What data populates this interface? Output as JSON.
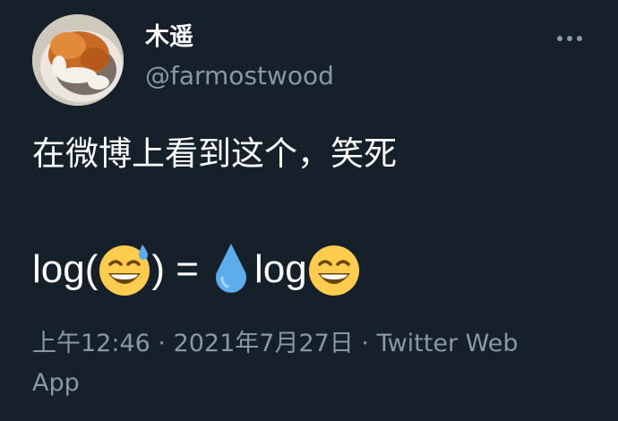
{
  "user": {
    "display_name": "木遥",
    "handle": "@farmostwood"
  },
  "tweet": {
    "text": "在微博上看到这个，笑死",
    "formula": {
      "part1": "log(",
      "emoji1": "sweat-smile-emoji",
      "part2": ") =",
      "emoji2": "droplet-emoji",
      "part3": "log",
      "emoji3": "grinning-smile-emoji"
    },
    "time": "上午12:46",
    "separator": " · ",
    "date": "2021年7月27日",
    "source": "Twitter Web App"
  },
  "colors": {
    "background": "#15202b",
    "primary_text": "#ffffff",
    "secondary_text": "#8899a6",
    "emoji_yellow": "#ffcc4d",
    "droplet_blue": "#5dadec"
  },
  "icons": {
    "more": "more-dots-icon"
  }
}
